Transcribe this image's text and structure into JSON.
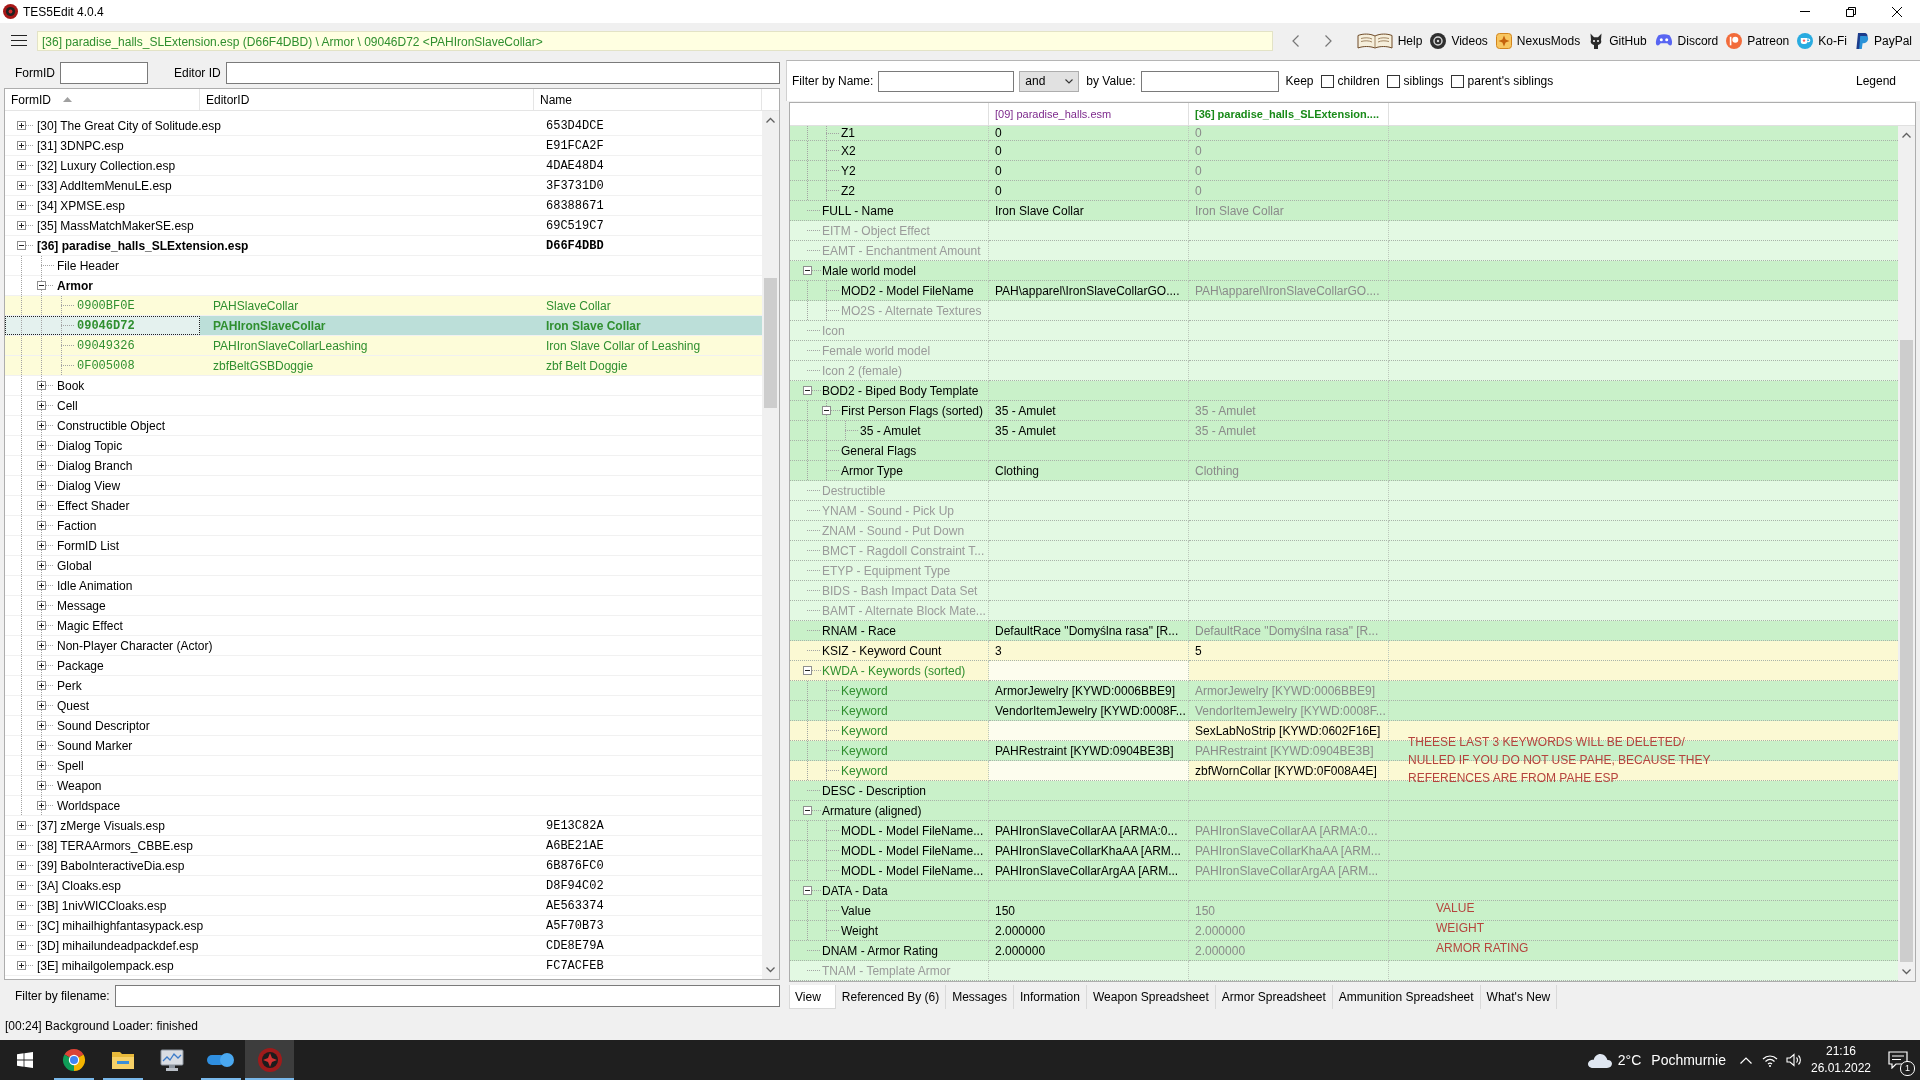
{
  "window": {
    "title": "TES5Edit 4.0.4"
  },
  "toolbar": {
    "path": "[36] paradise_halls_SLExtension.esp (D66F4DBD) \\ Armor \\ 09046D72 <PAHIronSlaveCollar>",
    "links": [
      {
        "label": "Help"
      },
      {
        "label": "Videos"
      },
      {
        "label": "NexusMods"
      },
      {
        "label": "GitHub"
      },
      {
        "label": "Discord"
      },
      {
        "label": "Patreon"
      },
      {
        "label": "Ko-Fi"
      },
      {
        "label": "PayPal"
      }
    ]
  },
  "object_tree": {
    "formid_filter": {
      "label": "FormID"
    },
    "editor_id_filter": {
      "label": "Editor ID"
    },
    "columns": [
      {
        "label": "FormID",
        "sorted": true
      },
      {
        "label": "EditorID",
        "sorted": false
      },
      {
        "label": "Name",
        "sorted": false
      }
    ],
    "rows": [
      {
        "kind": "node",
        "label": "[30] The Great City of Solitude.esp",
        "name": "653D4DCE",
        "expanded": false,
        "selected": false
      },
      {
        "kind": "node",
        "label": "[31] 3DNPC.esp",
        "name": "E91FCA2F",
        "expanded": false,
        "selected": false
      },
      {
        "kind": "node",
        "label": "[32] Luxury Collection.esp",
        "name": "4DAE48D4",
        "expanded": false,
        "selected": false
      },
      {
        "kind": "node",
        "label": "[33] AddItemMenuLE.esp",
        "name": "3F3731D0",
        "expanded": false,
        "selected": false
      },
      {
        "kind": "node",
        "label": "[34] XPMSE.esp",
        "name": "68388671",
        "expanded": false,
        "selected": false
      },
      {
        "kind": "node",
        "label": "[35] MassMatchMakerSE.esp",
        "name": "69C519C7",
        "expanded": false,
        "selected": false
      },
      {
        "kind": "node",
        "label": "[36] paradise_halls_SLExtension.esp",
        "name": "D66F4DBD",
        "expanded": true,
        "selected": false,
        "children": [
          {
            "kind": "node",
            "label": "File Header",
            "selected": false
          },
          {
            "kind": "node",
            "label": "Armor",
            "expanded": true,
            "selected": false,
            "children": [
              {
                "kind": "record",
                "form_id": "0900BF0E",
                "editor_id": "PAHSlaveCollar",
                "name": "Slave Collar",
                "selected": false
              },
              {
                "kind": "record",
                "form_id": "09046D72",
                "editor_id": "PAHIronSlaveCollar",
                "name": "Iron Slave Collar",
                "selected": true
              },
              {
                "kind": "record",
                "form_id": "09049326",
                "editor_id": "PAHIronSlaveCollarLeashing",
                "name": "Iron Slave Collar of Leashing",
                "selected": false
              },
              {
                "kind": "record",
                "form_id": "0F005008",
                "editor_id": "zbfBeltGSBDoggie",
                "name": "zbf Belt Doggie",
                "selected": false
              }
            ]
          },
          {
            "kind": "node",
            "label": "Book",
            "expanded": false,
            "selected": false
          },
          {
            "kind": "node",
            "label": "Cell",
            "expanded": false,
            "selected": false
          },
          {
            "kind": "node",
            "label": "Constructible Object",
            "expanded": false,
            "selected": false
          },
          {
            "kind": "node",
            "label": "Dialog Topic",
            "expanded": false,
            "selected": false
          },
          {
            "kind": "node",
            "label": "Dialog Branch",
            "expanded": false,
            "selected": false
          },
          {
            "kind": "node",
            "label": "Dialog View",
            "expanded": false,
            "selected": false
          },
          {
            "kind": "node",
            "label": "Effect Shader",
            "expanded": false,
            "selected": false
          },
          {
            "kind": "node",
            "label": "Faction",
            "expanded": false,
            "selected": false
          },
          {
            "kind": "node",
            "label": "FormID List",
            "expanded": false,
            "selected": false
          },
          {
            "kind": "node",
            "label": "Global",
            "expanded": false,
            "selected": false
          },
          {
            "kind": "node",
            "label": "Idle Animation",
            "expanded": false,
            "selected": false
          },
          {
            "kind": "node",
            "label": "Message",
            "expanded": false,
            "selected": false
          },
          {
            "kind": "node",
            "label": "Magic Effect",
            "expanded": false,
            "selected": false
          },
          {
            "kind": "node",
            "label": "Non-Player Character (Actor)",
            "expanded": false,
            "selected": false
          },
          {
            "kind": "node",
            "label": "Package",
            "expanded": false,
            "selected": false
          },
          {
            "kind": "node",
            "label": "Perk",
            "expanded": false,
            "selected": false
          },
          {
            "kind": "node",
            "label": "Quest",
            "expanded": false,
            "selected": false
          },
          {
            "kind": "node",
            "label": "Sound Descriptor",
            "expanded": false,
            "selected": false
          },
          {
            "kind": "node",
            "label": "Sound Marker",
            "expanded": false,
            "selected": false
          },
          {
            "kind": "node",
            "label": "Spell",
            "expanded": false,
            "selected": false
          },
          {
            "kind": "node",
            "label": "Weapon",
            "expanded": false,
            "selected": false
          },
          {
            "kind": "node",
            "label": "Worldspace",
            "expanded": false,
            "selected": false
          }
        ]
      },
      {
        "kind": "node",
        "label": "[37] zMerge Visuals.esp",
        "name": "9E13C82A",
        "expanded": false,
        "selected": false
      },
      {
        "kind": "node",
        "label": "[38] TERAArmors_CBBE.esp",
        "name": "A6BE21AE",
        "expanded": false,
        "selected": false
      },
      {
        "kind": "node",
        "label": "[39] BaboInteractiveDia.esp",
        "name": "6B876FC0",
        "expanded": false,
        "selected": false
      },
      {
        "kind": "node",
        "label": "[3A] Cloaks.esp",
        "name": "D8F94C02",
        "expanded": false,
        "selected": false
      },
      {
        "kind": "node",
        "label": "[3B] 1nivWICCloaks.esp",
        "name": "AE563374",
        "expanded": false,
        "selected": false
      },
      {
        "kind": "node",
        "label": "[3C] mihailhighfantasypack.esp",
        "name": "A5F70B73",
        "expanded": false,
        "selected": false
      },
      {
        "kind": "node",
        "label": "[3D] mihailundeadpackdef.esp",
        "name": "CDE8E79A",
        "expanded": false,
        "selected": false
      },
      {
        "kind": "node",
        "label": "[3E] mihailgolempack.esp",
        "name": "FC7ACFEB",
        "expanded": false,
        "selected": false
      }
    ],
    "filename_filter": {
      "label": "Filter by filename:"
    }
  },
  "record_view": {
    "filter": {
      "name_label": "Filter by Name:",
      "operator": "and",
      "value_label": "by Value:",
      "keep_label": "Keep",
      "keep_options": [
        {
          "label": "children",
          "checked": false
        },
        {
          "label": "siblings",
          "checked": false
        },
        {
          "label": "parent's siblings",
          "checked": false
        }
      ],
      "legend": "Legend"
    },
    "columns": [
      {
        "label": "[09] paradise_halls.esm",
        "kind": "master"
      },
      {
        "label": "[36] paradise_halls_SLExtension....",
        "kind": "override"
      }
    ],
    "rows": [
      {
        "children": [
          {
            "label": "Z1",
            "master_value": "0",
            "override_value": "0",
            "kind": "identical",
            "modified": false
          },
          {
            "label": "X2",
            "master_value": "0",
            "override_value": "0",
            "kind": "identical",
            "modified": false
          },
          {
            "label": "Y2",
            "master_value": "0",
            "override_value": "0",
            "kind": "identical",
            "modified": false
          },
          {
            "label": "Z2",
            "master_value": "0",
            "override_value": "0",
            "kind": "identical",
            "modified": false
          }
        ]
      },
      {
        "label": "FULL - Name",
        "master_value": "Iron Slave Collar",
        "override_value": "Iron Slave Collar",
        "kind": "identical",
        "modified": false
      },
      {
        "label": "EITM - Object Effect",
        "kind": "absent",
        "modified": false
      },
      {
        "label": "EAMT - Enchantment Amount",
        "kind": "absent",
        "modified": false
      },
      {
        "label": "Male world model",
        "kind": "identical",
        "modified": false,
        "expanded": true,
        "children": [
          {
            "label": "MOD2 - Model FileName",
            "master_value": "PAH\\apparel\\IronSlaveCollarGO....",
            "override_value": "PAH\\apparel\\IronSlaveCollarGO....",
            "kind": "identical",
            "modified": false
          },
          {
            "label": "MO2S - Alternate Textures",
            "kind": "absent",
            "modified": false
          }
        ]
      },
      {
        "label": "Icon",
        "kind": "absent",
        "modified": false
      },
      {
        "label": "Female world model",
        "kind": "absent",
        "modified": false
      },
      {
        "label": "Icon 2 (female)",
        "kind": "absent",
        "modified": false
      },
      {
        "label": "BOD2 - Biped Body Template",
        "kind": "identical",
        "modified": false,
        "expanded": true,
        "children": [
          {
            "label": "First Person Flags (sorted)",
            "master_value": "35 - Amulet",
            "override_value": "35 - Amulet",
            "kind": "identical",
            "modified": false,
            "expanded": true,
            "children": [
              {
                "label": "35 - Amulet",
                "master_value": "35 - Amulet",
                "override_value": "35 - Amulet",
                "kind": "identical",
                "modified": false
              }
            ]
          },
          {
            "label": "General Flags",
            "kind": "identical",
            "modified": false
          },
          {
            "label": "Armor Type",
            "master_value": "Clothing",
            "override_value": "Clothing",
            "kind": "identical",
            "modified": false
          }
        ]
      },
      {
        "label": "Destructible",
        "kind": "absent",
        "modified": false
      },
      {
        "label": "YNAM - Sound - Pick Up",
        "kind": "absent",
        "modified": false
      },
      {
        "label": "ZNAM - Sound - Put Down",
        "kind": "absent",
        "modified": false
      },
      {
        "label": "BMCT - Ragdoll Constraint T...",
        "kind": "absent",
        "modified": false
      },
      {
        "label": "ETYP - Equipment Type",
        "kind": "absent",
        "modified": false
      },
      {
        "label": "BIDS - Bash Impact Data Set",
        "kind": "absent",
        "modified": false
      },
      {
        "label": "BAMT - Alternate Block Mate...",
        "kind": "absent",
        "modified": false
      },
      {
        "label": "RNAM - Race",
        "master_value": "DefaultRace \"Domyślna rasa\" [R...",
        "override_value": "DefaultRace \"Domyślna rasa\" [R...",
        "kind": "identical",
        "modified": false
      },
      {
        "label": "KSIZ - Keyword Count",
        "master_value": "3",
        "override_value": "5",
        "kind": "conflict",
        "modified": false
      },
      {
        "label": "KWDA - Keywords (sorted)",
        "kind": "conflict",
        "modified": true,
        "expanded": true,
        "children": [
          {
            "label": "Keyword",
            "master_value": "ArmorJewelry [KYWD:0006BBE9]",
            "override_value": "ArmorJewelry [KYWD:0006BBE9]",
            "kind": "identical",
            "modified": true
          },
          {
            "label": "Keyword",
            "master_value": "VendorItemJewelry [KYWD:0008F...",
            "override_value": "VendorItemJewelry [KYWD:0008F...",
            "kind": "identical",
            "modified": true
          },
          {
            "label": "Keyword",
            "override_value": "SexLabNoStrip [KYWD:0602F16E]",
            "kind": "conflict",
            "modified": true
          },
          {
            "label": "Keyword",
            "master_value": "PAHRestraint [KYWD:0904BE3B]",
            "override_value": "PAHRestraint [KYWD:0904BE3B]",
            "kind": "identical",
            "modified": true,
            "note": [
              "THEESE LAST 3 KEYWORDS WILL BE DELETED/",
              "NULLED IF YOU DO NOT USE PAHE, BECAUSE THEY",
              "REFERENCES ARE FROM PAHE ESP"
            ]
          },
          {
            "label": "Keyword",
            "override_value": "zbfWornCollar [KYWD:0F008A4E]",
            "kind": "conflict",
            "modified": true
          }
        ]
      },
      {
        "label": "DESC - Description",
        "kind": "identical",
        "modified": false
      },
      {
        "label": "Armature (aligned)",
        "kind": "identical",
        "modified": false,
        "expanded": true,
        "children": [
          {
            "label": "MODL - Model FileName...",
            "master_value": "PAHIronSlaveCollarAA [ARMA:0...",
            "override_value": "PAHIronSlaveCollarAA [ARMA:0...",
            "kind": "identical",
            "modified": false
          },
          {
            "label": "MODL - Model FileName...",
            "master_value": "PAHIronSlaveCollarKhaAA [ARM...",
            "override_value": "PAHIronSlaveCollarKhaAA [ARM...",
            "kind": "identical",
            "modified": false
          },
          {
            "label": "MODL - Model FileName...",
            "master_value": "PAHIronSlaveCollarArgAA [ARM...",
            "override_value": "PAHIronSlaveCollarArgAA [ARM...",
            "kind": "identical",
            "modified": false
          }
        ]
      },
      {
        "label": "DATA - Data",
        "kind": "identical",
        "modified": false,
        "expanded": true,
        "children": [
          {
            "label": "Value",
            "master_value": "150",
            "override_value": "150",
            "kind": "identical",
            "modified": false,
            "note": [
              "VALUE"
            ]
          },
          {
            "label": "Weight",
            "master_value": "2.000000",
            "override_value": "2.000000",
            "kind": "identical",
            "modified": false,
            "note": [
              "WEIGHT"
            ]
          }
        ]
      },
      {
        "label": "DNAM - Armor Rating",
        "master_value": "2.000000",
        "override_value": "2.000000",
        "kind": "identical",
        "modified": false,
        "note": [
          "ARMOR RATING"
        ]
      },
      {
        "label": "TNAM - Template Armor",
        "kind": "absent",
        "modified": false
      }
    ],
    "tabs": [
      {
        "label": "View",
        "selected": true
      },
      {
        "label": "Referenced By (6)",
        "selected": false
      },
      {
        "label": "Messages",
        "selected": false
      },
      {
        "label": "Information",
        "selected": false
      },
      {
        "label": "Weapon Spreadsheet",
        "selected": false
      },
      {
        "label": "Armor Spreadsheet",
        "selected": false
      },
      {
        "label": "Ammunition Spreadsheet",
        "selected": false
      },
      {
        "label": "What's New",
        "selected": false
      }
    ]
  },
  "status_bar": {
    "message": "[00:24] Background Loader: finished"
  },
  "taskbar": {
    "apps": [
      {
        "kind": "browser",
        "running": true,
        "active": false
      },
      {
        "kind": "folder",
        "running": true,
        "active": false
      },
      {
        "kind": "monitor",
        "running": false,
        "active": false
      },
      {
        "kind": "capsule",
        "running": true,
        "active": false
      },
      {
        "kind": "emblem",
        "running": true,
        "active": true
      }
    ],
    "weather": {
      "temperature": "2°C",
      "condition": "Pochmurnie"
    },
    "clock": {
      "time": "21:16",
      "date": "26.01.2022"
    },
    "notification_count": "1"
  }
}
